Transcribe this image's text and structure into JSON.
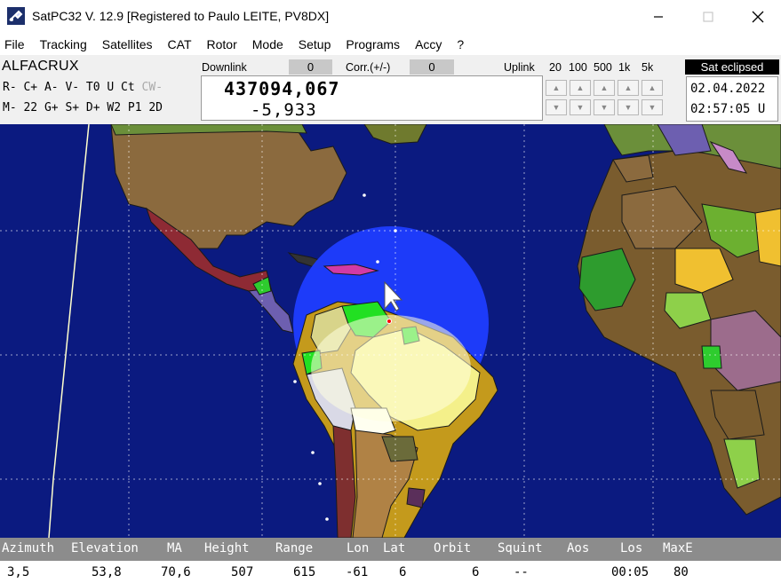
{
  "window": {
    "title": "SatPC32 V. 12.9   [Registered to Paulo LEITE, PV8DX]",
    "min_icon": "minimize-icon",
    "max_icon": "maximize-icon",
    "close_icon": "close-icon"
  },
  "menu": [
    "File",
    "Tracking",
    "Satellites",
    "CAT",
    "Rotor",
    "Mode",
    "Setup",
    "Programs",
    "Accy",
    "?"
  ],
  "panel": {
    "satellite": "ALFACRUX",
    "cmd_row1_a": "R- C+ A- V- T0 U Ct ",
    "cmd_row1_b": "CW-",
    "cmd_row2": "M- 22 G+ S+ D+ W2 P1 2D",
    "downlink_label": "Downlink",
    "downlink_value": "0",
    "corr_label": "Corr.(+/-)",
    "corr_value": "0",
    "uplink_label": "Uplink",
    "steps": [
      "20",
      "100",
      "500",
      "1k",
      "5k"
    ],
    "frequency": "437094,067",
    "offset": "-5,933",
    "status": "Sat eclipsed",
    "date": "02.04.2022",
    "time": "02:57:05 U"
  },
  "data_table": {
    "headers": [
      "Azimuth",
      "Elevation",
      "MA",
      "Height",
      "Range",
      "Lon",
      "Lat",
      "Orbit",
      "Squint",
      "Aos",
      "Los",
      "MaxE"
    ],
    "values": [
      "3,5",
      "53,8",
      "70,6",
      "507",
      "615",
      "-61",
      "6",
      "6",
      "--",
      "",
      "00:05",
      "80"
    ]
  },
  "colors": {
    "ocean": "#0b1a80",
    "footprint": "#1f3dff",
    "status_bg": "#000000"
  }
}
